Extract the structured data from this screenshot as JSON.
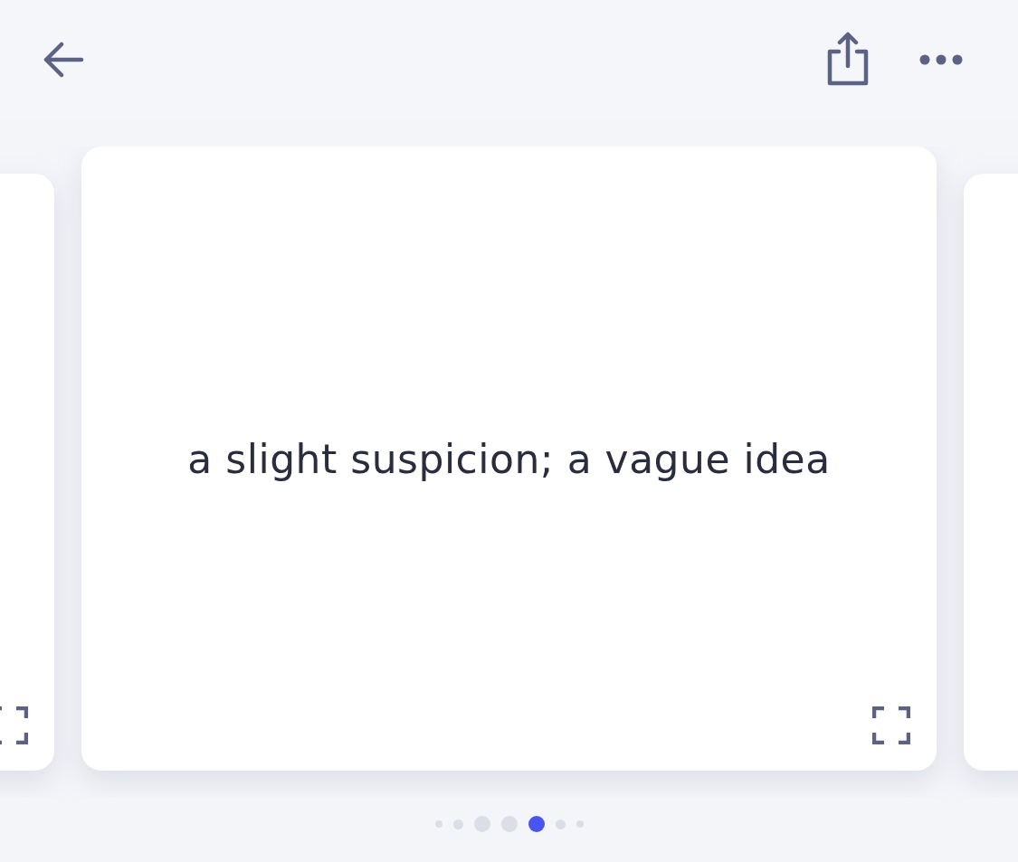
{
  "cards": [
    {
      "selected": false
    },
    {
      "selected": true,
      "text": "a slight suspicion; a vague idea"
    },
    {
      "selected": false
    }
  ],
  "pager": [
    {
      "selected": false
    },
    {
      "selected": false
    },
    {
      "selected": false
    },
    {
      "selected": false
    },
    {
      "selected": true
    },
    {
      "selected": false
    },
    {
      "selected": false
    }
  ]
}
